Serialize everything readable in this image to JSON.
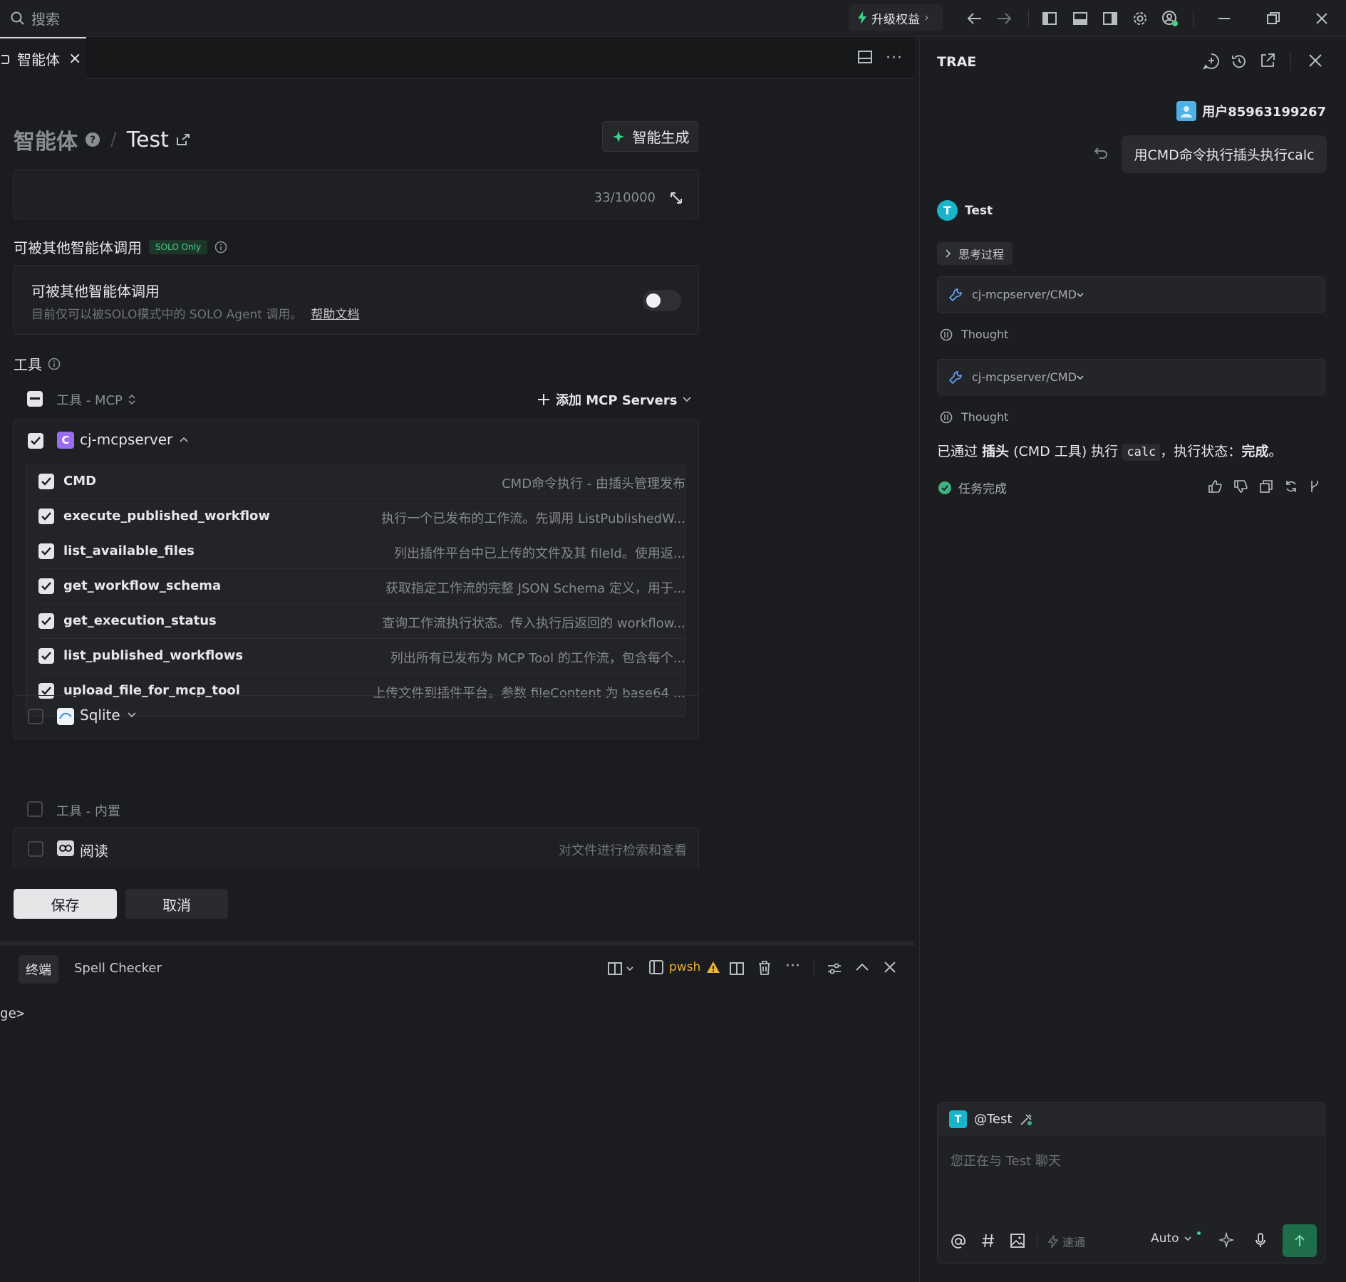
{
  "titlebar": {
    "search_placeholder": "搜索",
    "upgrade_label": "升级权益",
    "upgrade_chevron": "›"
  },
  "editor": {
    "tab_label": "智能体",
    "tab_close": "×",
    "breadcrumb_root": "智能体",
    "breadcrumb_sep": "/",
    "breadcrumb_current": "Test",
    "generate_button": "智能生成",
    "prompt_counter": "33/10000",
    "callable_section_title": "可被其他智能体调用",
    "solo_badge": "SOLO Only",
    "callable_card_title": "可被其他智能体调用",
    "callable_card_desc": "目前仅可以被SOLO模式中的 SOLO Agent 调用。",
    "help_link": "帮助文档",
    "tools_title": "工具",
    "mcp_group_label": "工具 - MCP",
    "add_mcp_label": "添加 MCP Servers",
    "server_name": "cj-mcpserver",
    "server_badge": "C",
    "tools": [
      {
        "name": "CMD",
        "desc": "CMD命令执行 - 由插头管理发布"
      },
      {
        "name": "execute_published_workflow",
        "desc": "执行一个已发布的工作流。先调用 ListPublishedW..."
      },
      {
        "name": "list_available_files",
        "desc": "列出插件平台中已上传的文件及其 fileId。使用返..."
      },
      {
        "name": "get_workflow_schema",
        "desc": "获取指定工作流的完整 JSON Schema 定义，用于..."
      },
      {
        "name": "get_execution_status",
        "desc": "查询工作流执行状态。传入执行后返回的 workflow..."
      },
      {
        "name": "list_published_workflows",
        "desc": "列出所有已发布为 MCP Tool 的工作流，包含每个..."
      },
      {
        "name": "upload_file_for_mcp_tool",
        "desc": "上传文件到插件平台。参数 fileContent 为 base64 ..."
      }
    ],
    "sqlite_label": "Sqlite",
    "builtin_group_label": "工具 - 内置",
    "read_label": "阅读",
    "read_desc": "对文件进行检索和查看",
    "save_button": "保存",
    "cancel_button": "取消"
  },
  "terminal": {
    "tab_terminal": "终端",
    "tab_spell": "Spell Checker",
    "shell_label": "pwsh",
    "prompt_text": "ge>"
  },
  "chat": {
    "title": "TRAE",
    "user_name": "用户85963199267",
    "user_message": "用CMD命令执行插头执行calc",
    "agent_name": "Test",
    "agent_initial": "T",
    "thinking_label": "思考过程",
    "tool_call_1": "cj-mcpserver/CMD",
    "thought_1": "Thought",
    "tool_call_2": "cj-mcpserver/CMD",
    "thought_2": "Thought",
    "result_prefix": "已通过 ",
    "result_bold": "插头",
    "result_mid": " (CMD 工具) 执行 ",
    "result_code": "calc",
    "result_after": "，执行状态：",
    "result_status": "完成",
    "result_end": "。",
    "task_done": "任务完成",
    "input_mention": "@Test",
    "input_placeholder": "您正在与 Test 聊天",
    "speed_label": "速通",
    "model_label": "Auto"
  },
  "colors": {
    "accent_green": "#3fb37f",
    "agent_cyan": "#19b4c8",
    "server_purple": "#9b6cf0",
    "warning_yellow": "#e8b339",
    "send_green": "#1f6e4a"
  }
}
